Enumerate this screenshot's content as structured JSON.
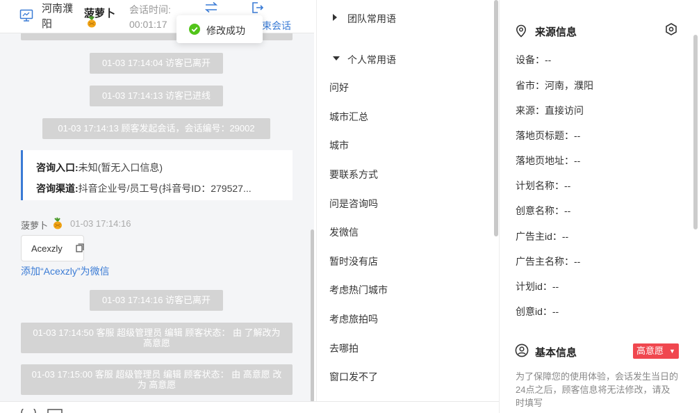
{
  "header": {
    "location": "河南濮阳",
    "visitor_name": "菠萝卜",
    "session_time_label": "会话时间:",
    "session_time_value": "00:01:17",
    "end_session_label": "束会话"
  },
  "toast": {
    "message": "修改成功"
  },
  "chat": {
    "events": [
      "01-03 17:14:04 访客已离开",
      "01-03 17:14:13 访客已进线",
      "01-03 17:14:13 顾客发起会话，会话编号：29002",
      "01-03 17:14:16 访客已离开",
      "01-03 17:14:50 客服 超级管理员 编辑 顾客状态： 由 了解改为 高意愿",
      "01-03 17:15:00 客服 超级管理员 编辑 顾客状态： 由 高意愿 改为 高意愿"
    ],
    "consult": {
      "entry_label": "咨询入口:",
      "entry_value": "未知(暂无入口信息)",
      "channel_label": "咨询渠道:",
      "channel_value": "抖音企业号/员工号(抖音号ID：279527..."
    },
    "message": {
      "sender": "菠萝卜",
      "time": "01-03 17:14:16",
      "text": "Acexzly",
      "add_wechat": "添加“Acexzly”为微信"
    }
  },
  "phrases": {
    "team_group": "团队常用语",
    "personal_group": "个人常用语",
    "items": [
      "问好",
      "城市汇总",
      "城市",
      "要联系方式",
      "问是咨询吗",
      "发微信",
      "暂时没有店",
      "考虑热门城市",
      "考虑旅拍吗",
      "去哪拍",
      "窗口发不了"
    ]
  },
  "info": {
    "source_title": "来源信息",
    "rows": [
      "设备：--",
      "省市：河南，濮阳",
      "来源：直接访问",
      "落地页标题：--",
      "落地页地址：--",
      "计划名称：--",
      "创意名称：--",
      "广告主id：--",
      "广告主名称：--",
      "计划id：--",
      "创意id：--"
    ],
    "basic_title": "基本信息",
    "intent_badge": "高意愿",
    "notice": "为了保障您的使用体验，会话发生当日的24点之后，顾客信息将无法修改，请及时填写"
  },
  "colors": {
    "accent": "#3a7bd5",
    "badge": "#f0474f",
    "success": "#52c41a"
  }
}
